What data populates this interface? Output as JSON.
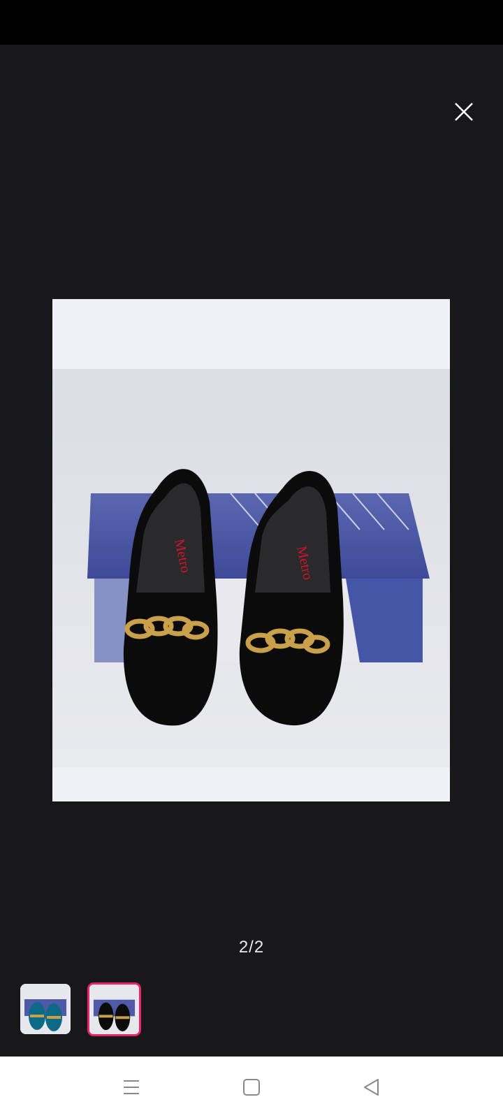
{
  "viewer": {
    "counter": "2/2",
    "current_index": 2,
    "total": 2,
    "close_icon": "close-icon",
    "image_description_brand": "Metro"
  },
  "thumbnails": [
    {
      "name": "teal-loafers",
      "selected": false
    },
    {
      "name": "black-loafers",
      "selected": true
    }
  ],
  "colors": {
    "background": "#18181a",
    "accent": "#e8246b",
    "nav_bar": "#ffffff"
  },
  "nav": {
    "menu_icon": "menu-icon",
    "home_icon": "home-icon",
    "back_icon": "back-icon"
  }
}
